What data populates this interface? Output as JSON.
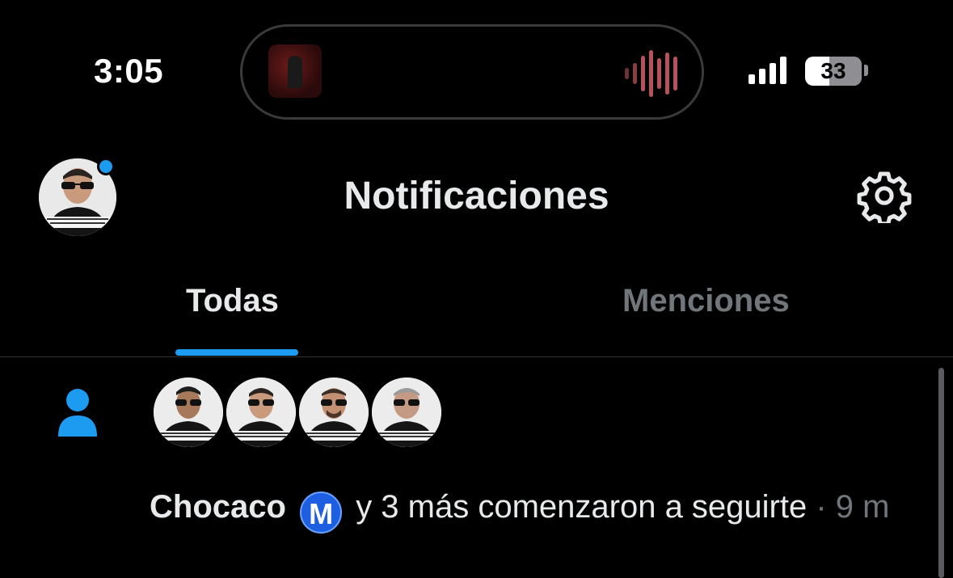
{
  "status_bar": {
    "time": "3:05",
    "battery": "33",
    "wave_color": "#b6535a"
  },
  "header": {
    "title": "Notificaciones",
    "settings_icon": "gear-icon",
    "notification_dot_color": "#1d9bf0"
  },
  "tabs": [
    {
      "label": "Todas",
      "active": true
    },
    {
      "label": "Menciones",
      "active": false
    }
  ],
  "notification": {
    "icon": "person-icon",
    "name": "Chocaco",
    "badge": "M",
    "text": " y 3 más comenzaron a seguirte",
    "time": " · 9 m",
    "follower_count": 4
  },
  "colors": {
    "accent": "#1d9bf0",
    "muted": "#71767b",
    "text": "#e7e9ea",
    "background": "#000000"
  }
}
